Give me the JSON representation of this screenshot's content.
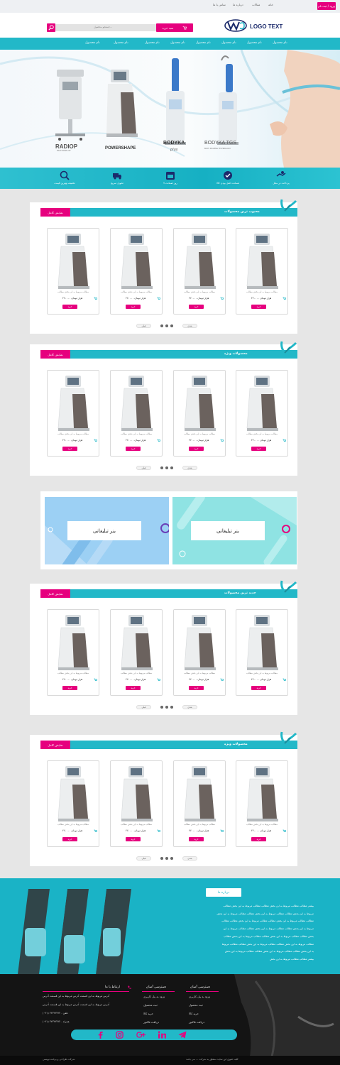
{
  "topbar": {
    "login": "ورود / ثبت نام",
    "links": [
      "تماس با ما",
      "درباره ما",
      "مقالات",
      "خانه"
    ]
  },
  "header": {
    "logo_text": "LOGO TEXT",
    "search_placeholder": "جستجو محصول...",
    "search_button": "جستجو",
    "cart_label": "سبد خرید"
  },
  "nav": {
    "items": [
      "نام محصول",
      "نام محصول",
      "نام محصول",
      "نام محصول",
      "نام محصول",
      "نام محصول",
      "نام محصول",
      "نام محصول"
    ]
  },
  "hero": {
    "products": [
      {
        "brand": "RADIOP",
        "sub": "FRACTIONAL RF"
      },
      {
        "brand": "POWERSHAPE",
        "sub": ""
      },
      {
        "brand": "BODYKA",
        "sub": "plus"
      },
      {
        "brand": "BODYKA TGS",
        "sub": "BODY SHAPING TECHNOLOGY"
      }
    ]
  },
  "features": [
    {
      "icon": "handshake-icon",
      "label": "پرداخت در محل"
    },
    {
      "icon": "check-circle-icon",
      "label": "ضمانت اصل بودن کالا"
    },
    {
      "icon": "calendar-icon",
      "label": "۷ روز ضمانت"
    },
    {
      "icon": "truck-icon",
      "label": "تحویل سریع"
    },
    {
      "icon": "support-icon",
      "label": "تخفیف بهترین قیمت"
    }
  ],
  "product_template": {
    "desc": "مطالب مربوط به این بخش مطالب",
    "price": "۲۶۰۰۰۰ هزار تومان",
    "buy": "خرید",
    "next": "بعدی",
    "prev": "قبلی"
  },
  "sections": [
    {
      "title": "محبوب ترین محصولات",
      "view_all": "نمایش کامل"
    },
    {
      "title": "محصولات ویژه",
      "view_all": "نمایش کامل"
    },
    {
      "title": "جدید ترین محصولات",
      "view_all": "نمایش کامل"
    },
    {
      "title": "محصولات ویژه",
      "view_all": "نمایش کامل"
    }
  ],
  "banners": [
    "بنر تبلیغاتی",
    "بنر تبلیغاتی"
  ],
  "about": {
    "title": "درباره ما",
    "lines": [
      "بیشتر مطالب مطالب مربوط به این بخش مطالب مطالب مربوط به این بخش مطالب",
      "مربوط به این بخش مطالب مطالب مربوط به این بخش مطالب مطالب مربوط به این بخش",
      "مطالب مطالب مربوط به این بخش مطالب مطالب مربوط به این بخش مطالب مطالب",
      "مربوط به این بخش مطالب مطالب مربوط به این بخش مطالب مطالب مربوط به این",
      "بخش مطالب مطالب مربوط به این بخش مطالب مطالب مربوط به این بخش مطالب",
      "مطالب مربوط به این بخش مطالب مطالب مربوط به این بخش مطالب مطالب مربوط",
      "به این بخش مطالب مطالب مربوط به این بخش مطالب مطالب مربوط به این بخش",
      "بیشتر مطالب مطالب مربوط به این بخش"
    ]
  },
  "footer": {
    "col1": {
      "title": "دسترسی آسان",
      "links": [
        "ورود به پنل کاربری",
        "ثبت محصول",
        "خرید کالا",
        "دریافت فاکتور"
      ]
    },
    "col2": {
      "title": "دسترسی آسان",
      "links": [
        "ورود به پنل کاربری",
        "ثبت محصول",
        "خرید کالا",
        "دریافت فاکتور"
      ]
    },
    "col3": {
      "title": "ارتباط با ما",
      "lines": [
        "آدرس مربوط به این قسمت آدرس مربوط به این قسمت آدرس",
        "آدرس مربوط به این قسمت آدرس مربوط به این قسمت آدرس",
        "(۰۲۱) ۲۲۲۲۲۲۲۲ - تلفن",
        "(۰۲۱) ۲۲۲۲۲۲۲۲ - همراه"
      ]
    },
    "social": [
      "facebook-icon",
      "instagram-icon",
      "google-plus-icon",
      "linkedin-icon",
      "telegram-icon"
    ],
    "copyright_right": "کلیه حقوق این سایت متعلق به شرکت ... می باشد",
    "copyright_left": "شرکت طراحی و برنامه نویسی"
  },
  "colors": {
    "accent": "#e6007e",
    "brand": "#22b8c8",
    "dark": "#141414"
  }
}
